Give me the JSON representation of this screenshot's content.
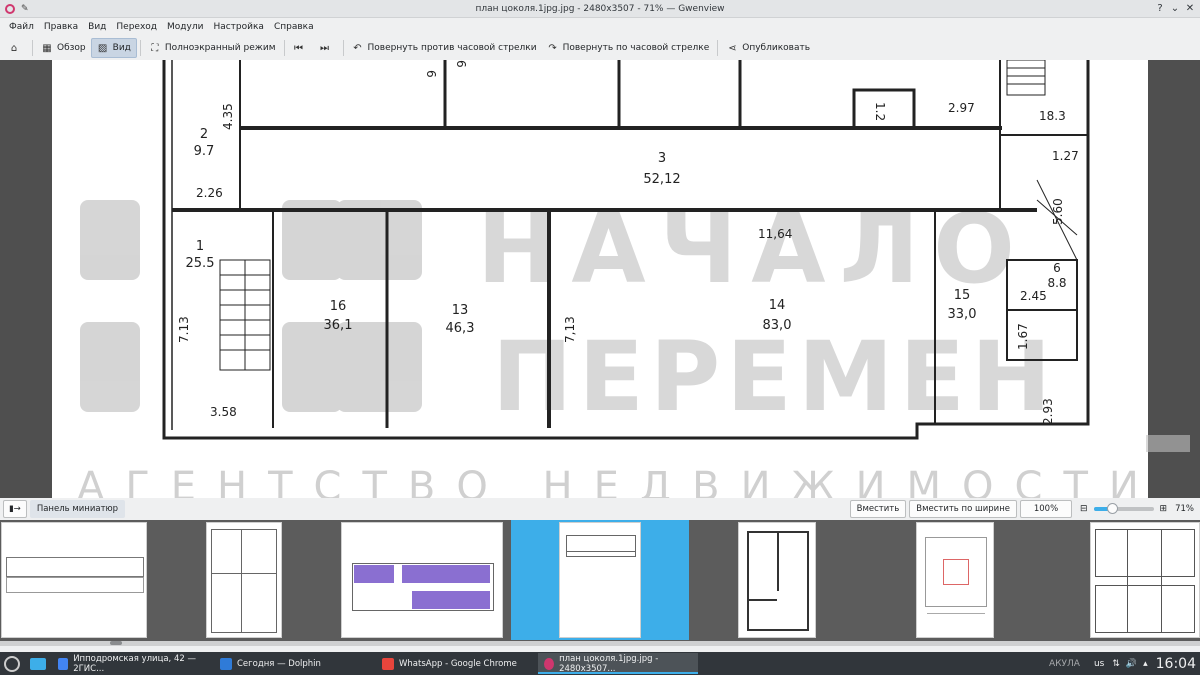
{
  "window": {
    "title": "план цоколя.1jpg.jpg - 2480x3507 - 71% — Gwenview"
  },
  "menu": [
    "Файл",
    "Правка",
    "Вид",
    "Переход",
    "Модули",
    "Настройка",
    "Справка"
  ],
  "toolbar": {
    "browse": "Обзор",
    "view": "Вид",
    "fullscreen": "Полноэкранный режим",
    "rotate_left": "Повернуть против часовой стрелки",
    "rotate_right": "Повернуть по часовой стрелке",
    "share": "Опубликовать"
  },
  "plan": {
    "rooms": [
      {
        "num": "2",
        "area": "9.7"
      },
      {
        "num": "3",
        "area": "52,12"
      },
      {
        "num": "1",
        "area": "25.5"
      },
      {
        "num": "16",
        "area": "36,1"
      },
      {
        "num": "13",
        "area": "46,3"
      },
      {
        "num": "14",
        "area": "83,0"
      },
      {
        "num": "15",
        "area": "33,0"
      },
      {
        "num": "6",
        "area": "8.8"
      }
    ],
    "dims": [
      "4.35",
      "2.26",
      "7.13",
      "3.58",
      "7,13",
      "11,64",
      "2.97",
      "18.3",
      "1.27",
      "5.60",
      "2.45",
      "1.67",
      "2.93",
      "1.2",
      "6",
      "6"
    ],
    "watermark_line1": "НАЧАЛО",
    "watermark_line2": "ПЕРЕМЕН",
    "watermark_line3": "АГЕНТСТВО НЕДВИЖИМОСТИ"
  },
  "statusbar": {
    "thumb_panel": "Панель миниатюр",
    "fit": "Вместить",
    "fit_width": "Вместить по ширине",
    "zoom_100": "100%",
    "zoom_level": "71%",
    "zoom_fraction": 0.3
  },
  "taskbar": {
    "tasks": [
      {
        "label": "Ипподромская улица, 42 — 2ГИС...",
        "color": "#4285f4"
      },
      {
        "label": "Сегодня — Dolphin",
        "color": "#2f7bd8"
      },
      {
        "label": "WhatsApp - Google Chrome",
        "color": "#e8453c"
      },
      {
        "label": "план цоколя.1jpg.jpg - 2480x3507...",
        "color": "#d0376e"
      }
    ],
    "keyboard": "us",
    "clock": "16:04",
    "brand": "АКУЛА"
  }
}
